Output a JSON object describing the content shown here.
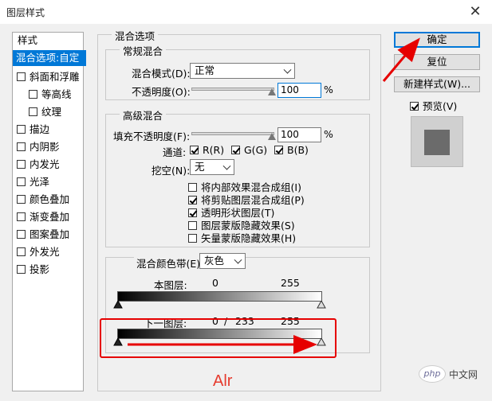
{
  "window": {
    "title": "图层样式",
    "close_glyph": "✕"
  },
  "style_list": {
    "header": "样式",
    "items": [
      {
        "label": "混合选项:自定",
        "selected": true,
        "has_checkbox": false,
        "indent": false
      },
      {
        "label": "斜面和浮雕",
        "has_checkbox": true,
        "indent": false
      },
      {
        "label": "等高线",
        "has_checkbox": true,
        "indent": true
      },
      {
        "label": "纹理",
        "has_checkbox": true,
        "indent": true
      },
      {
        "label": "描边",
        "has_checkbox": true,
        "indent": false
      },
      {
        "label": "内阴影",
        "has_checkbox": true,
        "indent": false
      },
      {
        "label": "内发光",
        "has_checkbox": true,
        "indent": false
      },
      {
        "label": "光泽",
        "has_checkbox": true,
        "indent": false
      },
      {
        "label": "颜色叠加",
        "has_checkbox": true,
        "indent": false
      },
      {
        "label": "渐变叠加",
        "has_checkbox": true,
        "indent": false
      },
      {
        "label": "图案叠加",
        "has_checkbox": true,
        "indent": false
      },
      {
        "label": "外发光",
        "has_checkbox": true,
        "indent": false
      },
      {
        "label": "投影",
        "has_checkbox": true,
        "indent": false
      }
    ]
  },
  "blend_options": {
    "title": "混合选项",
    "general": {
      "title": "常规混合",
      "blend_mode_label": "混合模式(D):",
      "blend_mode_value": "正常",
      "opacity_label": "不透明度(O):",
      "opacity_value": "100",
      "opacity_unit": "%"
    },
    "advanced": {
      "title": "高级混合",
      "fill_opacity_label": "填充不透明度(F):",
      "fill_opacity_value": "100",
      "fill_opacity_unit": "%",
      "channels_label": "通道:",
      "channel_r": "R(R)",
      "channel_g": "G(G)",
      "channel_b": "B(B)",
      "knockout_label": "挖空(N):",
      "knockout_value": "无",
      "options": [
        {
          "label": "将内部效果混合成组(I)",
          "checked": false
        },
        {
          "label": "将剪贴图层混合成组(P)",
          "checked": true
        },
        {
          "label": "透明形状图层(T)",
          "checked": true
        },
        {
          "label": "图层蒙版隐藏效果(S)",
          "checked": false
        },
        {
          "label": "矢量蒙版隐藏效果(H)",
          "checked": false
        }
      ]
    },
    "blend_if": {
      "label": "混合颜色带(E):",
      "value": "灰色",
      "this_layer_label": "本图层:",
      "this_layer_min": "0",
      "this_layer_max": "255",
      "underlying_label": "下一图层:",
      "underlying_min": "0",
      "underlying_sep": "/",
      "underlying_mid": "233",
      "underlying_max": "255"
    }
  },
  "buttons": {
    "ok": "确定",
    "reset": "复位",
    "new_style": "新建样式(W)...",
    "preview_label": "预览(V)"
  },
  "annotation": {
    "text": "Alr",
    "color": "#e60000"
  },
  "watermark": {
    "logo": "php",
    "text": "中文网"
  },
  "colors": {
    "selection": "#0078d7",
    "annotation": "#e60000"
  }
}
